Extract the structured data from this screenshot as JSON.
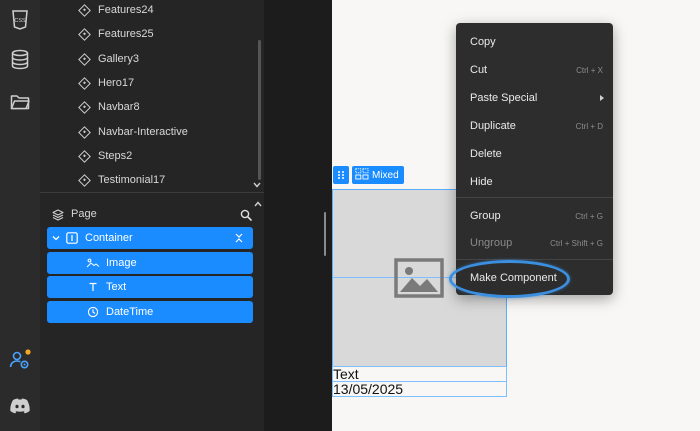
{
  "rail": {
    "icons": [
      "css-icon",
      "database-icon",
      "folder-icon",
      "user-settings-icon",
      "discord-icon"
    ],
    "notification_color": "#f5a623",
    "css_label": "CSS"
  },
  "components": {
    "items": [
      {
        "label": "Features24"
      },
      {
        "label": "Features25"
      },
      {
        "label": "Gallery3"
      },
      {
        "label": "Hero17"
      },
      {
        "label": "Navbar8"
      },
      {
        "label": "Navbar-Interactive"
      },
      {
        "label": "Steps2"
      },
      {
        "label": "Testimonial17"
      }
    ]
  },
  "layers": {
    "page_label": "Page",
    "items": [
      {
        "label": "Container"
      },
      {
        "label": "Image"
      },
      {
        "label": "Text"
      },
      {
        "label": "DateTime"
      }
    ]
  },
  "canvas": {
    "mixed_label": "Mixed",
    "text_value": "Text",
    "date_value": "13/05/2025"
  },
  "context_menu": {
    "items": [
      {
        "label": "Copy",
        "shortcut": ""
      },
      {
        "label": "Cut",
        "shortcut": "Ctrl + X"
      },
      {
        "label": "Paste Special",
        "shortcut": ""
      },
      {
        "label": "Duplicate",
        "shortcut": "Ctrl + D"
      },
      {
        "label": "Delete",
        "shortcut": ""
      },
      {
        "label": "Hide",
        "shortcut": ""
      },
      {
        "label": "Group",
        "shortcut": "Ctrl + G"
      },
      {
        "label": "Ungroup",
        "shortcut": "Ctrl + Shift + G"
      },
      {
        "label": "Make Component",
        "shortcut": ""
      }
    ]
  },
  "colors": {
    "accent": "#1a8cff",
    "highlight_ring": "#3b8fe0"
  }
}
